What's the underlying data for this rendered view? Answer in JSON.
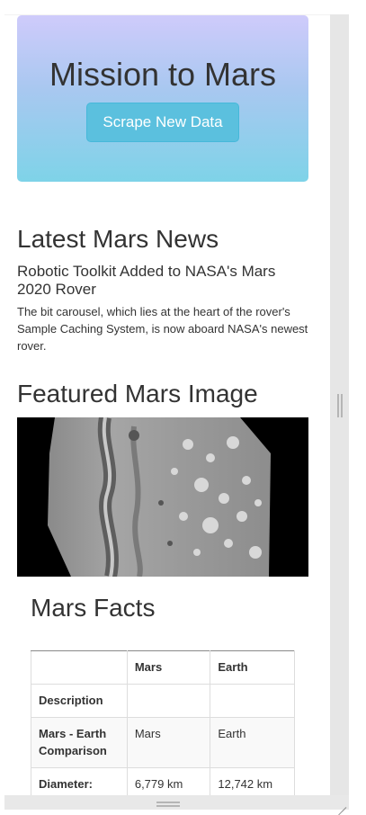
{
  "header": {
    "title": "Mission to Mars",
    "scrape_button_label": "Scrape New Data"
  },
  "news": {
    "section_title": "Latest Mars News",
    "headline": "Robotic Toolkit Added to NASA's Mars 2020 Rover",
    "teaser": "The bit carousel, which lies at the heart of the rover's Sample Caching System, is now aboard NASA's newest rover."
  },
  "featured": {
    "section_title": "Featured Mars Image"
  },
  "facts": {
    "section_title": "Mars Facts",
    "columns": [
      "",
      "Mars",
      "Earth"
    ],
    "rows": [
      {
        "label": "Description",
        "mars": "",
        "earth": ""
      },
      {
        "label": "Mars - Earth Comparison",
        "mars": "Mars",
        "earth": "Earth"
      },
      {
        "label": "Diameter:",
        "mars": "6,779 km",
        "earth": "12,742 km"
      }
    ]
  },
  "colors": {
    "jumbotron_top": "#cfcbfb",
    "jumbotron_bottom": "#7ed3e8",
    "button": "#5bc0de"
  }
}
